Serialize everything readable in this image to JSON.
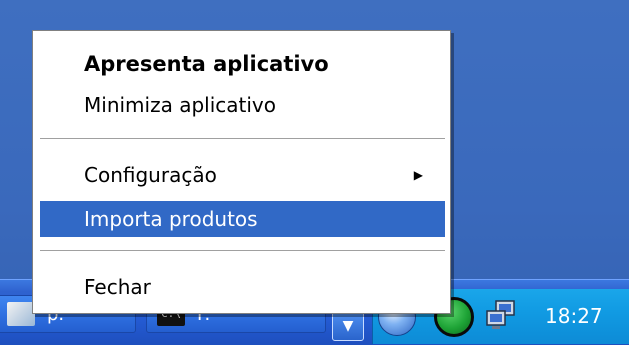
{
  "menu": {
    "items": [
      {
        "label": "Apresenta aplicativo"
      },
      {
        "label": "Minimiza aplicativo"
      },
      {
        "label": "Configuração",
        "submenu_icon": "triangle-right-icon"
      },
      {
        "label": "Importa produtos",
        "selected": true
      },
      {
        "label": "Fechar"
      }
    ]
  },
  "taskbar": {
    "buttons": [
      {
        "label": "p.",
        "icon": "app-window-icon"
      },
      {
        "label": "F.",
        "icon": "console-window-icon",
        "icon_text": "C:\\"
      }
    ],
    "show_hidden_icons": "chevron-down-icon",
    "tray_icons": [
      "blue-circle-arrow-icon",
      "green-status-icon",
      "network-icon"
    ],
    "clock": "18:27"
  },
  "colors": {
    "selection": "#3169c6",
    "desktop": "#3a69bc",
    "taskbar": "#245bd3",
    "tray": "#119be3"
  }
}
